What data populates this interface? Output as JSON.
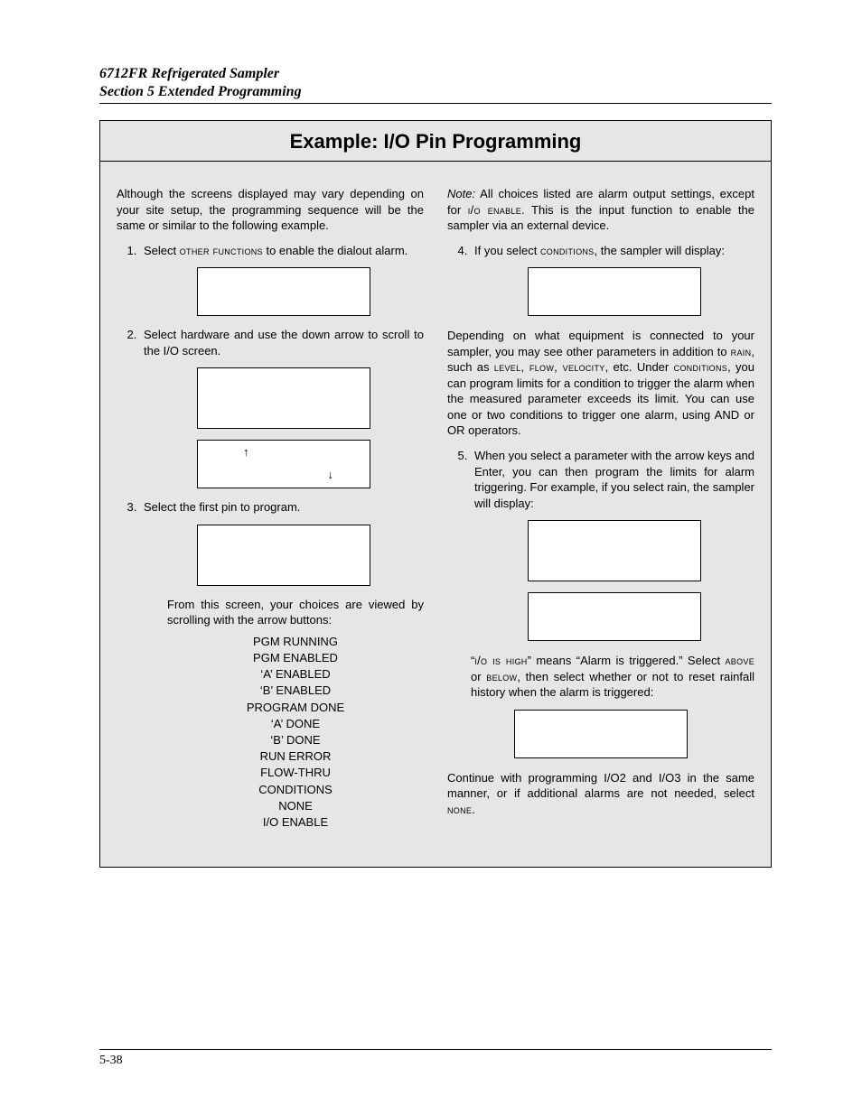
{
  "header": {
    "line1": "6712FR Refrigerated Sampler",
    "line2": "Section 5  Extended Programming"
  },
  "example": {
    "title": "Example: I/O Pin Programming",
    "intro": "Although the screens displayed may vary depending on your site setup, the programming sequence will be the same or similar to the following example.",
    "step1_a": "Select ",
    "step1_sc": "other functions",
    "step1_b": " to enable the dialout alarm.",
    "step2": "Select hardware and use the down arrow to scroll to the I/O screen.",
    "arrow_up": "↑",
    "arrow_down": "↓",
    "step3": "Select the first pin to program.",
    "after3": "From this screen, your choices are viewed by scrolling with the arrow buttons:",
    "choices": [
      "PGM RUNNING",
      "PGM ENABLED",
      "‘A’ ENABLED",
      "‘B’ ENABLED",
      "PROGRAM DONE",
      "‘A’ DONE",
      "‘B’ DONE",
      "RUN ERROR",
      "FLOW-THRU",
      "CONDITIONS",
      "NONE",
      "I/O ENABLE"
    ],
    "note_label": "Note:",
    "note_a": " All choices listed are alarm output settings, except for ",
    "note_sc": "i/o enable",
    "note_b": ". This is the input function to enable the sampler via an external device.",
    "step4_a": "If you select ",
    "step4_sc": "conditions",
    "step4_b": ", the sampler will display:",
    "after4_a": "Depending on what equipment is connected to your sampler, you may see other parameters in addition to ",
    "after4_sc1": "rain",
    "after4_b": ", such as ",
    "after4_sc2": "level, flow, velocity",
    "after4_c": ", etc. Under ",
    "after4_sc3": "conditions",
    "after4_d": ", you can program limits for a condition to trigger the alarm when the measured parameter exceeds its limit. You can use one or two conditions to trigger one alarm, using AND or OR operators.",
    "step5": "When you select a parameter with the arrow keys and Enter, you can then program the limits for alarm triggering. For example, if you select rain, the sampler will display:",
    "after5_a": "“",
    "after5_sc1": "i/o is high",
    "after5_b": "” means “Alarm is triggered.” Select ",
    "after5_sc2": "above",
    "after5_c": " or ",
    "after5_sc3": "below",
    "after5_d": ", then select whether or not to reset rainfall history when the alarm is triggered:",
    "closing_a": "Continue with programming I/O2 and I/O3 in the same manner, or if additional alarms are not needed, select ",
    "closing_sc": "none",
    "closing_b": "."
  },
  "page_number": "5-38"
}
